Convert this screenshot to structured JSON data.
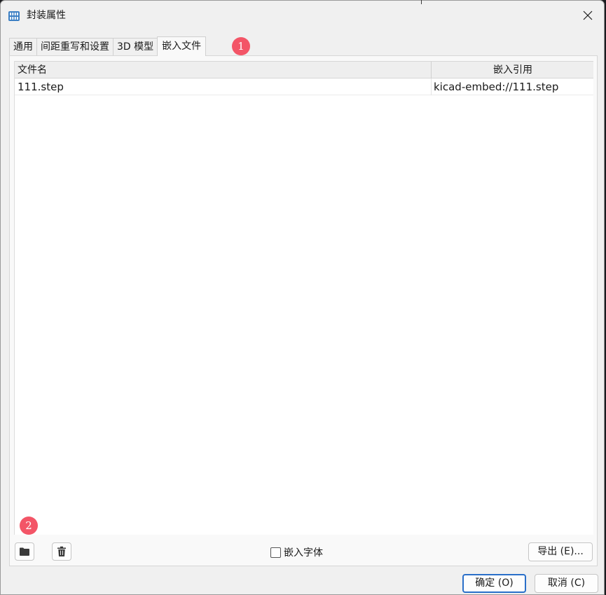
{
  "window": {
    "title": "封装属性",
    "icon": "footprint-grid-icon",
    "close_icon": "close-icon"
  },
  "tabs": [
    {
      "label": "通用",
      "active": false
    },
    {
      "label": "间距重写和设置",
      "active": false
    },
    {
      "label": "3D 模型",
      "active": false
    },
    {
      "label": "嵌入文件",
      "active": true
    }
  ],
  "annotations": {
    "badge_1": "1",
    "badge_2": "2",
    "badge_color": "#f35567"
  },
  "table": {
    "columns": [
      "文件名",
      "嵌入引用"
    ],
    "rows": [
      {
        "file_name": "111.step",
        "reference": "kicad-embed://111.step"
      }
    ]
  },
  "bottom_bar": {
    "add_icon": "folder-icon",
    "delete_icon": "trash-icon",
    "embed_fonts_label": "嵌入字体",
    "embed_fonts_checked": false,
    "export_label": "导出 (E)..."
  },
  "dialog_buttons": {
    "ok_label": "确定 (O)",
    "cancel_label": "取消 (C)"
  },
  "colors": {
    "accent": "#2a6fc9",
    "app_icon": "#3c7fc4"
  }
}
